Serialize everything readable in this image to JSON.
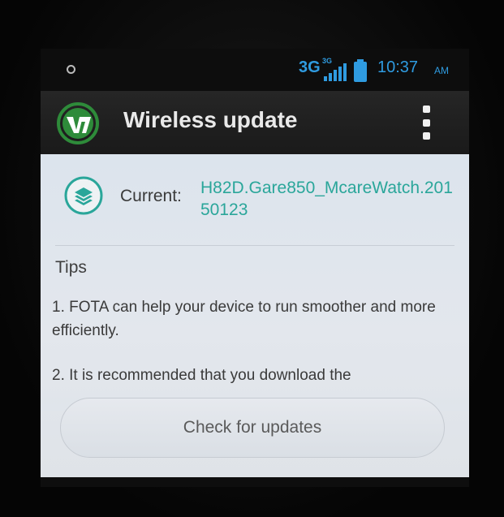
{
  "status_bar": {
    "network": "3G",
    "network_sup": "3G",
    "time": "10:37",
    "ampm": "AM",
    "icons": [
      "notification-dot-icon",
      "signal-icon",
      "battery-icon"
    ]
  },
  "action_bar": {
    "title": "Wireless update",
    "icons": [
      "fota-app-icon",
      "overflow-menu-icon"
    ]
  },
  "current": {
    "label": "Current:",
    "version": "H82D.Gare850_McareWatch.20150123",
    "icon": "layers-icon"
  },
  "tips": {
    "title": "Tips",
    "items": [
      "1. FOTA can help your device to run smoother and more efficiently.",
      "2. It is recommended that you download the"
    ]
  },
  "buttons": {
    "check_for_updates": "Check for updates"
  },
  "colors": {
    "accent_blue": "#2f9be0",
    "accent_teal": "#2aa69a",
    "app_green": "#2e8b3a"
  }
}
